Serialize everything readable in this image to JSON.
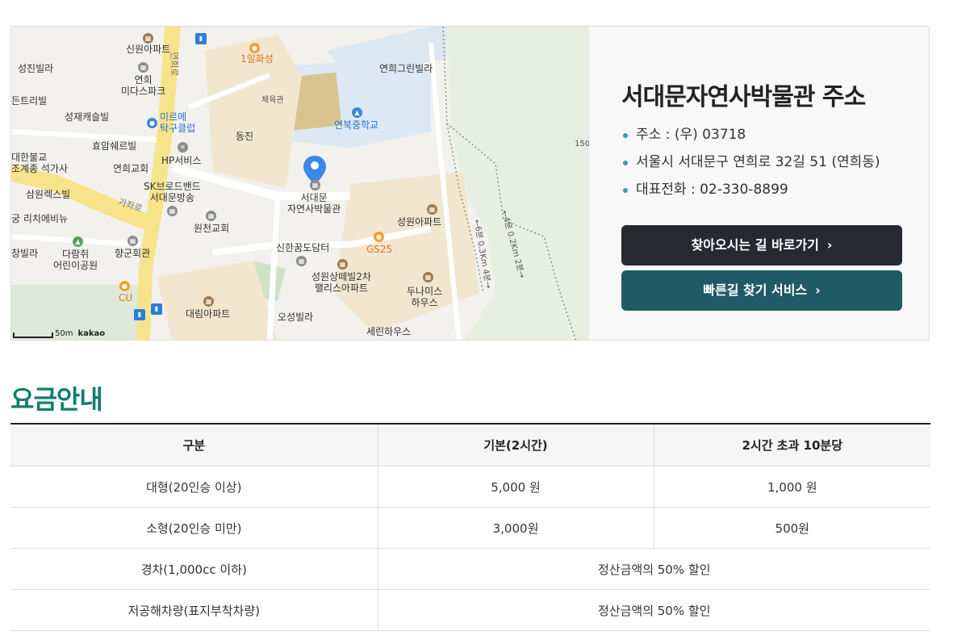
{
  "map": {
    "labels": {
      "seongjin": "성진빌라",
      "sinwon_apt": "신원아파트",
      "yeonhui_midaspark": "연희\n미다스파크",
      "deunteuribil": "든트리빌",
      "seongjae_castle": "성재캐슬빌",
      "mireume": "미르메\n탁구클럽",
      "hyoam": "효암쉐르빌",
      "hp_service": "HP서비스",
      "daehan_bulgyo": "대한불교\n조계종 석가사",
      "yeonhui_church": "연희교회",
      "samwon_rexvill": "삼원렉스빌",
      "sk_broadband": "SK브로드밴드\n서대문방송",
      "richevillage": "궁 리치에비뉴",
      "wonchun_church": "원천교회",
      "hyanggun": "향군회관",
      "darimjwi": "다람쥐\n어린이공원",
      "changbil": "창빌라",
      "cu": "CU",
      "daerim_apt": "대림아파트",
      "ilhwaseong": "1일화성",
      "dongjin": "동진",
      "gym": "체육관",
      "yeonbuk_ms": "연북중학교",
      "yeonhui_green": "연희그린빌라",
      "museum": "서대문\n자연사박물관",
      "seongwon_apt": "성원아파트",
      "gs25": "GS25",
      "shinhan": "신한꿈도담터",
      "seongwon_palace": "성원상떼빌2차\n팰리스아파트",
      "duna": "두나미스\n하우스",
      "oseong": "오성빌라",
      "serin": "세린하우스",
      "gichero": "가좌로",
      "yeonhuiro": "연희로",
      "trail1": "←6분 0.3Km 4분→",
      "trail2": "←4분 0.2Km 2분→",
      "elev": "150m"
    },
    "scale_text": "50m",
    "brand": "kakao"
  },
  "address": {
    "title": "서대문자연사박물관 주소",
    "items": [
      "주소 : (우) 03718",
      "서울시 서대문구 연희로 32길 51 (연희동)",
      "대표전화 : 02-330-8899"
    ],
    "btn_directions": "찾아오시는 길 바로가기",
    "btn_fastroute": "빠른길 찾기 서비스",
    "chevron": "›"
  },
  "fees": {
    "title": "요금안내",
    "headers": [
      "구분",
      "기본(2시간)",
      "2시간 초과 10분당"
    ],
    "rows": [
      {
        "type": "대형(20인승 이상)",
        "base": "5,000 원",
        "extra": "1,000 원"
      },
      {
        "type": "소형(20인승 미만)",
        "base": "3,000원",
        "extra": "500원"
      },
      {
        "type": "경차(1,000cc 이하)",
        "merged": "정산금액의 50% 할인"
      },
      {
        "type": "저공해차량(표지부착차량)",
        "merged": "정산금액의 50% 할인"
      }
    ]
  }
}
